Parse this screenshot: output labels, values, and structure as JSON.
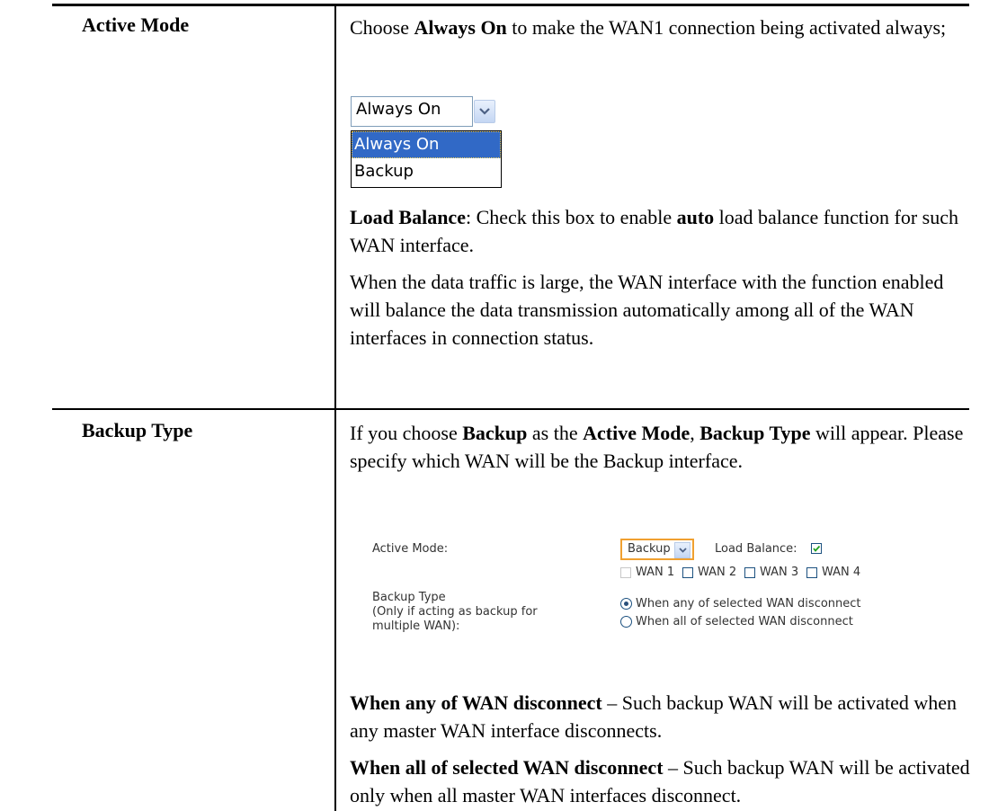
{
  "rows": [
    {
      "label": "Active Mode",
      "para1": {
        "pre": "Choose ",
        "b1": "Always On",
        "post": " to make the WAN1 connection being activated always;"
      },
      "dropdown": {
        "selected": "Always On",
        "options": [
          "Always On",
          "Backup"
        ],
        "highlighted": "Always On"
      },
      "para2": {
        "b1": "Load Balance",
        "mid1": ": Check this box to enable ",
        "b2": "auto",
        "post": " load balance function for such WAN interface."
      },
      "para3": "When the data traffic is large, the WAN interface with the function enabled will balance the data transmission automatically among all of the WAN interfaces in connection status."
    },
    {
      "label": "Backup Type",
      "para1": {
        "pre": "If you choose ",
        "b1": "Backup",
        "mid1": " as the ",
        "b2": "Active Mode",
        "mid2": ", ",
        "b3": "Backup Type",
        "post": " will appear. Please specify which WAN will be the Backup interface."
      },
      "screenshot": {
        "active_mode_label": "Active Mode:",
        "active_mode_value": "Backup",
        "load_balance_label": "Load Balance:",
        "load_balance_checked": true,
        "wans": [
          "WAN 1",
          "WAN 2",
          "WAN 3",
          "WAN 4"
        ],
        "backup_type_label_1": "Backup Type",
        "backup_type_label_2": "(Only if acting as backup for",
        "backup_type_label_3": "multiple WAN):",
        "option_any": "When any of selected WAN disconnect",
        "option_all": "When all of selected WAN disconnect",
        "selected_option": "any"
      },
      "para2": {
        "b1": "When any of WAN disconnect",
        "post": " – Such backup WAN will be activated when any master WAN interface disconnects."
      },
      "para3": {
        "b1": "When all of selected WAN disconnect",
        "post": " – Such backup WAN will be activated only when all master WAN interfaces disconnect."
      }
    }
  ]
}
